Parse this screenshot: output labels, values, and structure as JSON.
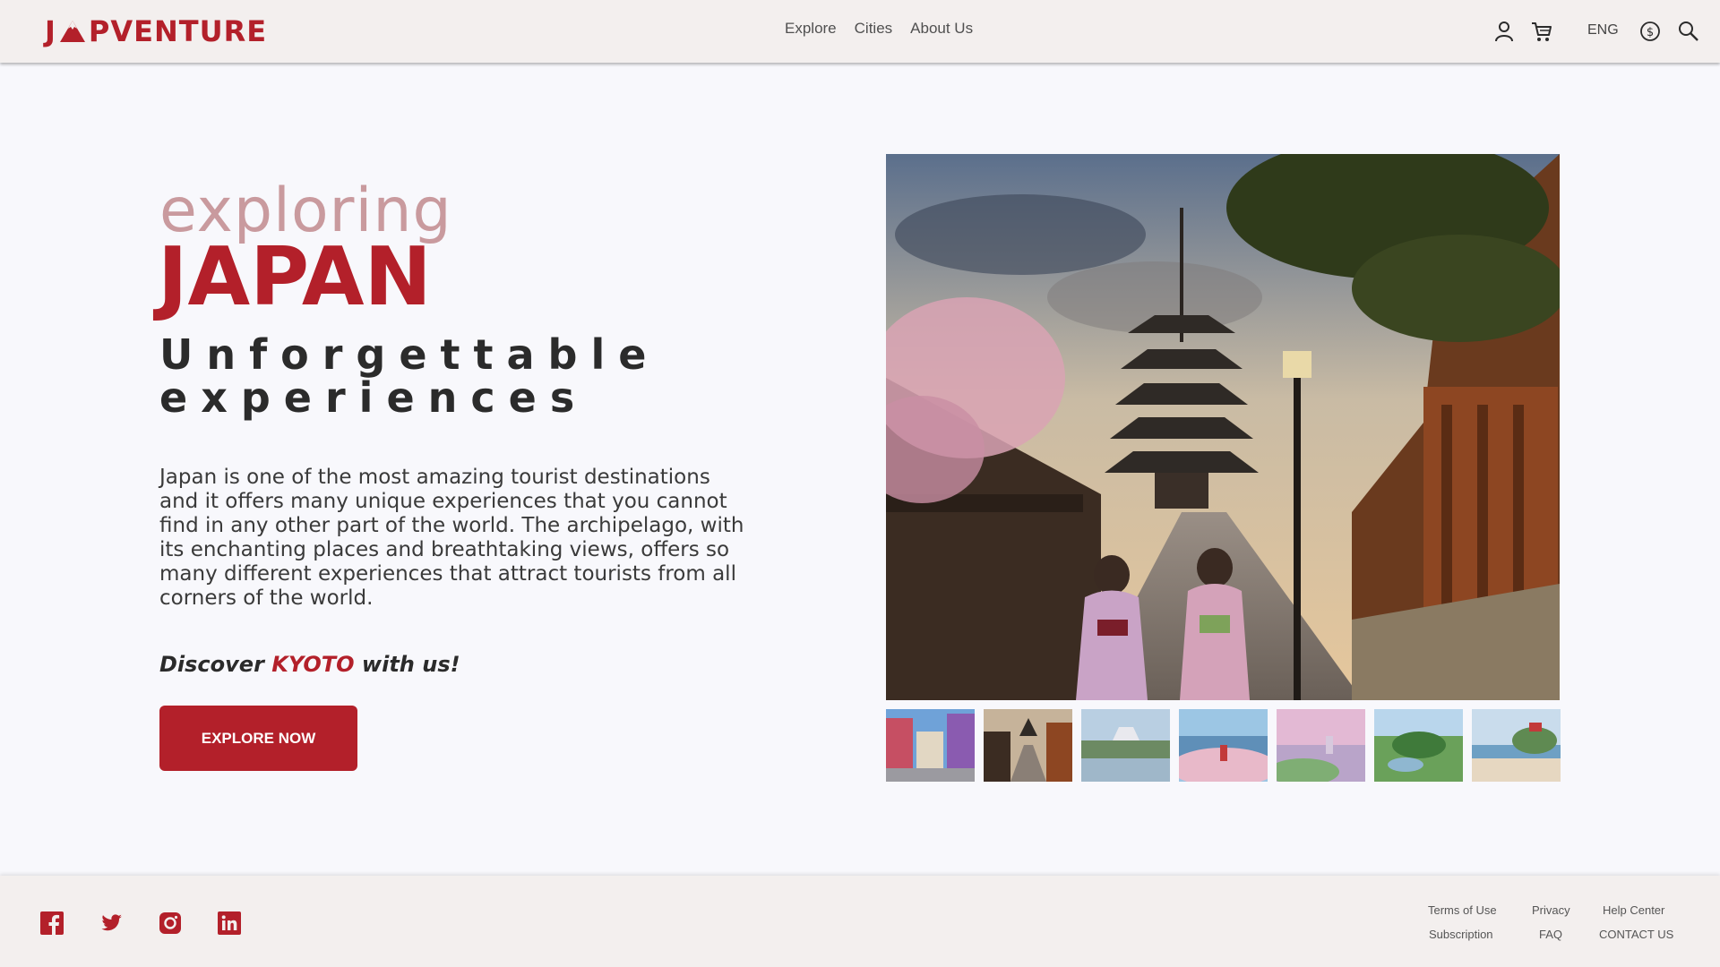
{
  "header": {
    "logo": {
      "left": "J",
      "right": "PVENTURE",
      "icon": "mount-fuji-icon"
    },
    "nav": [
      "Explore",
      "Cities",
      "About Us"
    ],
    "icons": [
      "user-icon",
      "cart-icon",
      "currency-icon",
      "search-icon"
    ],
    "language": "ENG"
  },
  "hero": {
    "kicker": "exploring",
    "title": "JAPAN",
    "tagline_line1": "Unforgettable",
    "tagline_line2": "experiences",
    "description": "Japan is one of the most amazing tourist destinations and it offers many unique experiences that you cannot find in any other part of the world. The archipelago, with its enchanting places and breathtaking views, offers so many different experiences that attract tourists from all corners of the world.",
    "discover_prefix": "Discover",
    "discover_city": "KYOTO",
    "discover_suffix": "with us!",
    "cta_label": "EXPLORE NOW"
  },
  "gallery": {
    "main_image": "kyoto-pagoda-street-photo",
    "thumbnails": [
      "tokyo-street-thumb",
      "kyoto-pagoda-thumb",
      "osaka-castle-thumb",
      "hiroshima-bay-thumb",
      "city-skyline-thumb",
      "japanese-garden-thumb",
      "coastal-temple-thumb"
    ]
  },
  "footer": {
    "social": [
      "facebook-icon",
      "twitter-icon",
      "instagram-icon",
      "linkedin-icon"
    ],
    "links_row1": [
      "Terms of Use",
      "Privacy",
      "Help Center"
    ],
    "links_row2": [
      "Subscription",
      "FAQ",
      "CONTACT US"
    ]
  },
  "colors": {
    "brand": "#b3202a",
    "kicker": "#c99a9e",
    "header_bg": "#f3efee",
    "page_bg": "#f8f8fc"
  }
}
